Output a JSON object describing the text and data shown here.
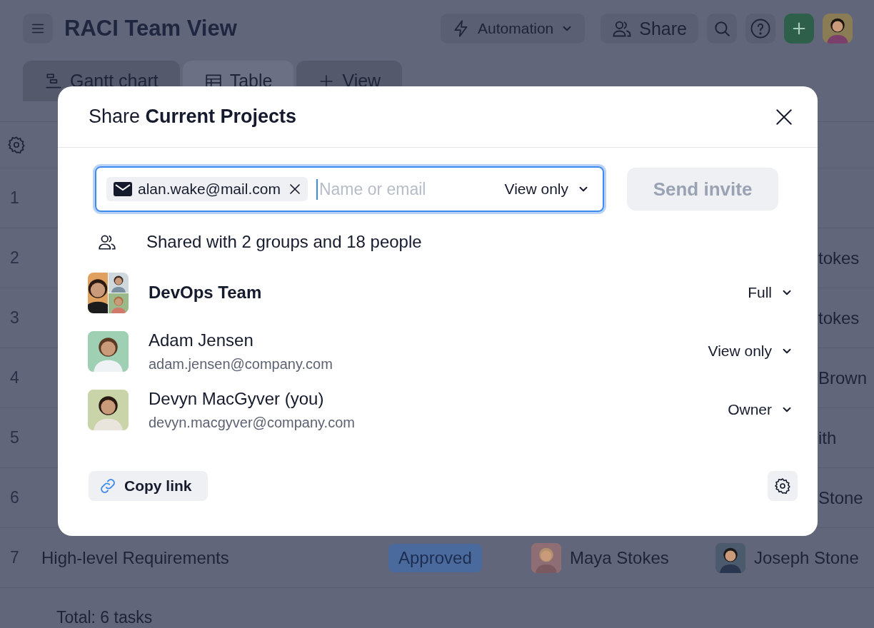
{
  "header": {
    "title": "RACI Team View",
    "automation": "Automation",
    "share": "Share"
  },
  "tabs": [
    {
      "label": "Gantt chart",
      "kind": "gantt",
      "selected": false
    },
    {
      "label": "Table",
      "kind": "table",
      "selected": true
    },
    {
      "label": "View",
      "kind": "add",
      "selected": false
    }
  ],
  "table": {
    "rows": [
      {
        "number": "1",
        "kind": "covered",
        "visible_text": ""
      },
      {
        "number": "2",
        "kind": "covered",
        "visible_text": "tokes"
      },
      {
        "number": "3",
        "kind": "covered",
        "visible_text": "tokes"
      },
      {
        "number": "4",
        "kind": "covered",
        "visible_text": "Brown"
      },
      {
        "number": "5",
        "kind": "covered",
        "visible_text": "ith"
      },
      {
        "number": "6",
        "kind": "covered",
        "visible_text": "Stone"
      },
      {
        "number": "7",
        "kind": "full",
        "task": "High-level Requirements",
        "status": "Approved",
        "responsible": "Maya Stokes",
        "accountable": "Joseph Stone"
      }
    ],
    "total": "Total: 6 tasks"
  },
  "dialog": {
    "title": "Share **Current Projects**",
    "invite": {
      "chips": [
        {
          "label": "alan.wake@mail.com"
        }
      ],
      "placeholder": "Name or email",
      "permission": "View only"
    },
    "send_button": {
      "label": "Send invite",
      "disabled": true
    },
    "shared_summary": "Shared with 2 groups and 18 people",
    "members": [
      {
        "kind": "group",
        "name": "DevOps Team",
        "role": "Full"
      },
      {
        "kind": "person",
        "name": "Adam Jensen",
        "email": "adam.jensen@company.com",
        "role": "View only"
      },
      {
        "kind": "person",
        "name": "Devyn MacGyver (you)",
        "email": "devyn.macgyver@company.com",
        "role": "Owner"
      }
    ],
    "copy_link": "Copy link"
  }
}
